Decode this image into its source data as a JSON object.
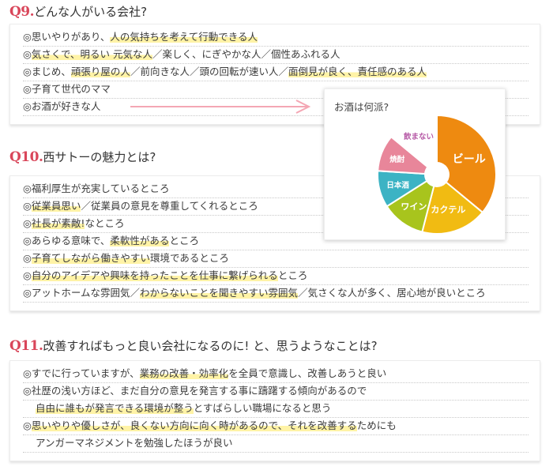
{
  "q9": {
    "num": "Q9",
    "dot": ".",
    "title": "どんな人がいる会社?",
    "lines": [
      {
        "segs": [
          [
            "◎思いやりがあり、",
            false
          ],
          [
            "人の気持ちを考えて行動できる人",
            true
          ]
        ]
      },
      {
        "segs": [
          [
            "◎",
            false
          ],
          [
            "気さくで、明るい 元気な人",
            true
          ],
          [
            "／楽しく、にぎやかな人／個性あふれる人",
            false
          ]
        ]
      },
      {
        "segs": [
          [
            "◎まじめ、",
            false
          ],
          [
            "頑張り屋の人",
            true
          ],
          [
            "／前向きな人／頭の回転が速い人／",
            false
          ],
          [
            "面倒見が良く、責任感のある人",
            true
          ]
        ]
      },
      {
        "segs": [
          [
            "◎子育て世代のママ",
            false
          ]
        ]
      },
      {
        "segs": [
          [
            "◎お酒が好きな人",
            false
          ]
        ]
      }
    ]
  },
  "q10": {
    "num": "Q10",
    "dot": ".",
    "title": "西サトーの魅力とは?",
    "lines": [
      {
        "segs": [
          [
            "◎福利厚生が充実しているところ",
            false
          ]
        ]
      },
      {
        "segs": [
          [
            "◎",
            false
          ],
          [
            "従業員思い",
            true
          ],
          [
            "／従業員の意見を尊重してくれるところ",
            false
          ]
        ]
      },
      {
        "segs": [
          [
            "◎",
            false
          ],
          [
            "社長が素敵!",
            true
          ],
          [
            "なところ",
            false
          ]
        ]
      },
      {
        "segs": [
          [
            "◎あらゆる意味で、",
            false
          ],
          [
            "柔軟性がある",
            true
          ],
          [
            "ところ",
            false
          ]
        ]
      },
      {
        "segs": [
          [
            "◎",
            false
          ],
          [
            "子育てしながら働きやすい",
            true
          ],
          [
            "環境であるところ",
            false
          ]
        ]
      },
      {
        "segs": [
          [
            "◎",
            false
          ],
          [
            "自分のアイデアや興味を持ったことを仕事に繋げられる",
            true
          ],
          [
            "ところ",
            false
          ]
        ]
      },
      {
        "segs": [
          [
            "◎アットホームな雰囲気／",
            false
          ],
          [
            "わからないことを聞きやすい雰囲気",
            true
          ],
          [
            "／気さくな人が多く、居心地が良いところ",
            false
          ]
        ]
      }
    ]
  },
  "q11": {
    "num": "Q11",
    "dot": ".",
    "title": "改善すればもっと良い会社になるのに! と、思うようなことは?",
    "lines": [
      {
        "segs": [
          [
            "◎すでに行っていますが、",
            false
          ],
          [
            "業務の改善・効率化",
            true
          ],
          [
            "を全員で意識し、改善しあうと良い",
            false
          ]
        ]
      },
      {
        "segs": [
          [
            "◎社歴の浅い方ほど、まだ自分の意見を発言する事に躊躇する傾向があるので",
            false
          ]
        ]
      },
      {
        "cont": true,
        "segs": [
          [
            "",
            false
          ],
          [
            "自由に誰もが発言できる環境が整う",
            true
          ],
          [
            "とすばらしい職場になると思う",
            false
          ]
        ]
      },
      {
        "segs": [
          [
            "◎",
            false
          ],
          [
            "思いやりや優しさが、良くない方向に向く時があるので、それを改善する",
            true
          ],
          [
            "ためにも",
            false
          ]
        ]
      },
      {
        "cont": true,
        "segs": [
          [
            "アンガーマネジメントを勉強したほうが良い",
            false
          ]
        ]
      }
    ]
  },
  "chart_data": {
    "type": "pie",
    "title": "お酒は何派?",
    "slices": [
      {
        "label": "ビール",
        "value": 36,
        "color": "#ee8a10",
        "text_color": "#ffffff"
      },
      {
        "label": "カクテル",
        "value": 18,
        "color": "#f1bb12",
        "text_color": "#ffffff"
      },
      {
        "label": "ワイン",
        "value": 12,
        "color": "#a8c41d",
        "text_color": "#ffffff"
      },
      {
        "label": "日本酒",
        "value": 10,
        "color": "#3cb3c4",
        "text_color": "#ffffff"
      },
      {
        "label": "焼酎",
        "value": 10,
        "color": "#e8869a",
        "text_color": "#ffffff"
      },
      {
        "label": "飲まない",
        "value": 14,
        "color": "#ffffff",
        "text_color": "#b659a6"
      }
    ]
  },
  "colors": {
    "accent": "#d9465a",
    "highlight": "#fff3a6",
    "arrow": "#f4a7b4"
  }
}
